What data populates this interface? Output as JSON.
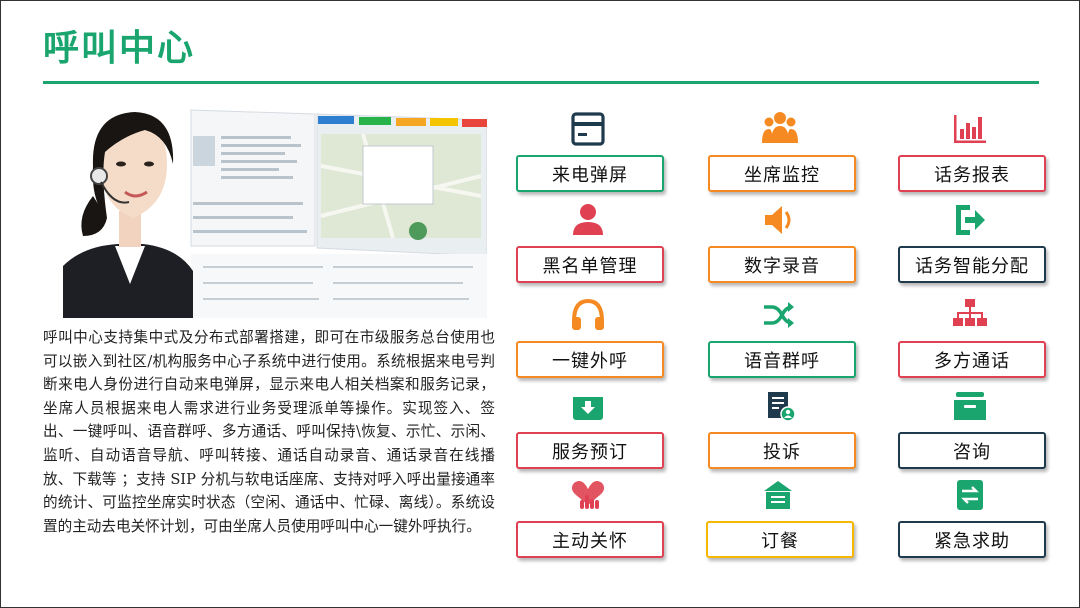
{
  "page": {
    "title": "呼叫中心",
    "description": "呼叫中心支持集中式及分布式部署搭建，即可在市级服务总台使用也可以嵌入到社区/机构服务中心子系统中进行使用。系统根据来电号判断来电人身份进行自动来电弹屏，显示来电人相关档案和服务记录，坐席人员根据来电人需求进行业务受理派单等操作。实现签入、签出、一键呼叫、语音群呼、多方通话、呼叫保持\\恢复、示忙、示闲、监听、自动语音导航、呼叫转接、通话自动录音、通话录音在线播放、下载等 ；支持 SIP 分机与软电话座席、支持对呼入呼出量接通率的统计、可监控坐席实时状态（空闲、通话中、忙碌、离线）。系统设置的主动去电关怀计划，可由坐席人员使用呼叫中心一键外呼执行。",
    "accent_color": "#1aa56f"
  },
  "features": [
    {
      "label": "来电弹屏",
      "icon": "id-card-icon",
      "color": "#1aa56f",
      "border": "#1aa56f"
    },
    {
      "label": "坐席监控",
      "icon": "group-icon",
      "color": "#f58a23",
      "border": "#f58a23"
    },
    {
      "label": "话务报表",
      "icon": "bar-chart-icon",
      "color": "#e04152",
      "border": "#e04152"
    },
    {
      "label": "黑名单管理",
      "icon": "user-icon",
      "color": "#e04152",
      "border": "#e04152"
    },
    {
      "label": "数字录音",
      "icon": "speaker-icon",
      "color": "#f58a23",
      "border": "#f58a23"
    },
    {
      "label": "话务智能分配",
      "icon": "sign-in-icon",
      "color": "#1aa56f",
      "border": "#1e3a4c"
    },
    {
      "label": "一键外呼",
      "icon": "headphones-icon",
      "color": "#f58a23",
      "border": "#f58a23"
    },
    {
      "label": "语音群呼",
      "icon": "shuffle-icon",
      "color": "#1aa56f",
      "border": "#1aa56f"
    },
    {
      "label": "多方通话",
      "icon": "sitemap-icon",
      "color": "#e04152",
      "border": "#e04152"
    },
    {
      "label": "服务预订",
      "icon": "archive-download-icon",
      "color": "#1aa56f",
      "border": "#e04152"
    },
    {
      "label": "投诉",
      "icon": "document-user-icon",
      "color": "#1e3a4c",
      "border": "#f58a23"
    },
    {
      "label": "咨询",
      "icon": "inbox-icon",
      "color": "#1aa56f",
      "border": "#1e3a4c"
    },
    {
      "label": "主动关怀",
      "icon": "heart-hand-icon",
      "color": "#e04152",
      "border": "#e04152"
    },
    {
      "label": "订餐",
      "icon": "house-list-icon",
      "color": "#1aa56f",
      "border": "#f5b800"
    },
    {
      "label": "紧急求助",
      "icon": "exchange-icon",
      "color": "#1aa56f",
      "border": "#1e3a4c"
    }
  ]
}
